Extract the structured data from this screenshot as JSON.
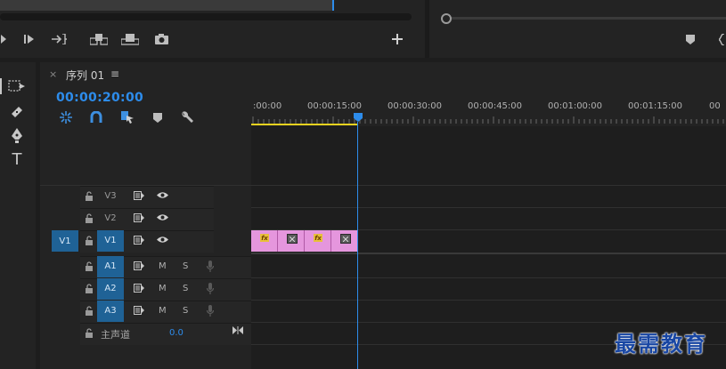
{
  "sequence": {
    "tab_close": "×",
    "title": "序列 01",
    "menu_glyph": "≡",
    "timecode": "00:00:20:00"
  },
  "ruler": {
    "labels": [
      ":00:00",
      "00:00:15:00",
      "00:00:30:00",
      "00:00:45:00",
      "00:01:00:00",
      "00:01:15:00",
      "00"
    ]
  },
  "tracks": {
    "video": [
      {
        "name": "V3",
        "source": ""
      },
      {
        "name": "V2",
        "source": ""
      },
      {
        "name": "V1",
        "source": "V1"
      }
    ],
    "audio": [
      {
        "name": "A1",
        "mute": "M",
        "solo": "S"
      },
      {
        "name": "A2",
        "mute": "M",
        "solo": "S"
      },
      {
        "name": "A3",
        "mute": "M",
        "solo": "S"
      }
    ],
    "master": {
      "label": "主声道",
      "value": "0.0"
    }
  },
  "clips": [
    {
      "badge": "fx"
    },
    {
      "badge": "x"
    },
    {
      "badge": "fx"
    },
    {
      "badge": "x"
    }
  ],
  "tools": {
    "type_glyph": "T"
  },
  "watermark": "最需教育",
  "colors": {
    "accent": "#2d8ceb",
    "track_target": "#1f6296",
    "clip": "#e596dd",
    "in_out": "#e7d21f"
  }
}
